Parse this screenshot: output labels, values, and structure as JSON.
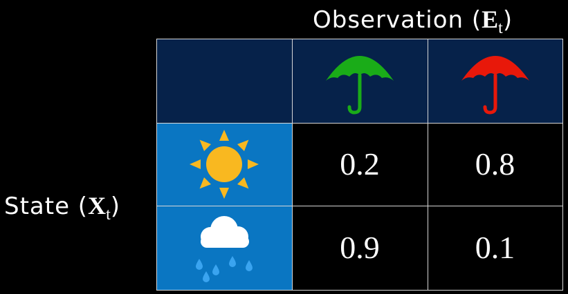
{
  "observation_axis": {
    "label": "Observation (",
    "var": "E",
    "sub": "t",
    "close": ")"
  },
  "state_axis": {
    "label": "State (",
    "var": "X",
    "sub": "t",
    "close": ")"
  },
  "columns": [
    {
      "icon": "umbrella-icon",
      "color": "#1aac18"
    },
    {
      "icon": "umbrella-icon",
      "color": "#e8180a"
    }
  ],
  "rows": [
    {
      "icon": "sun-icon",
      "color": "#f9b820",
      "values": [
        "0.2",
        "0.8"
      ]
    },
    {
      "icon": "rain-cloud-icon",
      "color": "#ffffff",
      "drop_color": "#3aa4f0",
      "values": [
        "0.9",
        "0.1"
      ]
    }
  ],
  "colors": {
    "header_bg": "#06224a",
    "state_bg": "#0a76c2",
    "value_bg": "#000000",
    "border": "#d8d8d8"
  }
}
